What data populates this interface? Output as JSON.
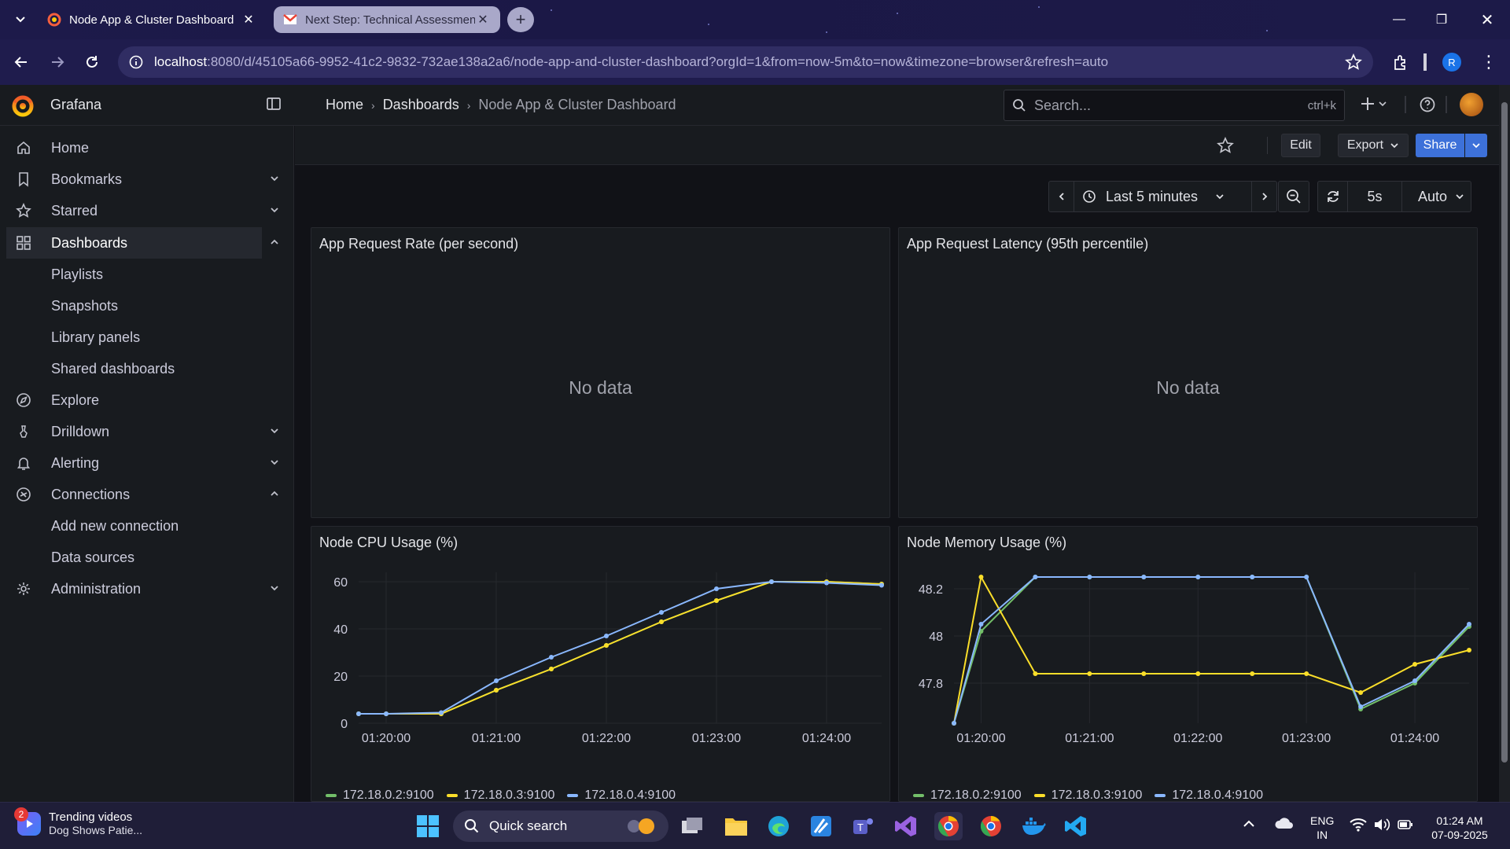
{
  "browser": {
    "tabs": [
      {
        "title": "Node App & Cluster Dashboard",
        "active": true
      },
      {
        "title": "Next Step: Technical Assessmen",
        "active": false
      }
    ],
    "url_host": "localhost",
    "url_rest": ":8080/d/45105a66-9952-41c2-9832-732ae138a2a6/node-app-and-cluster-dashboard?orgId=1&from=now-5m&to=now&timezone=browser&refresh=auto",
    "profile_initial": "R"
  },
  "grafana": {
    "app_title": "Grafana",
    "breadcrumbs": [
      "Home",
      "Dashboards",
      "Node App & Cluster Dashboard"
    ],
    "search_placeholder": "Search...",
    "search_shortcut": "ctrl+k",
    "actions": {
      "edit": "Edit",
      "export": "Export",
      "share": "Share"
    },
    "time_range": "Last 5 minutes",
    "refresh_interval": "5s",
    "auto": "Auto"
  },
  "sidebar": {
    "items": [
      {
        "label": "Home",
        "icon": "home-icon",
        "chevron": ""
      },
      {
        "label": "Bookmarks",
        "icon": "bookmark-icon",
        "chevron": "down"
      },
      {
        "label": "Starred",
        "icon": "star-icon",
        "chevron": "down"
      },
      {
        "label": "Dashboards",
        "icon": "apps-icon",
        "chevron": "up",
        "active": true
      },
      {
        "label": "Playlists",
        "sub": true
      },
      {
        "label": "Snapshots",
        "sub": true
      },
      {
        "label": "Library panels",
        "sub": true
      },
      {
        "label": "Shared dashboards",
        "sub": true
      },
      {
        "label": "Explore",
        "icon": "compass-icon",
        "chevron": ""
      },
      {
        "label": "Drilldown",
        "icon": "drilldown-icon",
        "chevron": "down"
      },
      {
        "label": "Alerting",
        "icon": "bell-icon",
        "chevron": "down"
      },
      {
        "label": "Connections",
        "icon": "connections-icon",
        "chevron": "up"
      },
      {
        "label": "Add new connection",
        "sub": true
      },
      {
        "label": "Data sources",
        "sub": true
      },
      {
        "label": "Administration",
        "icon": "cog-icon",
        "chevron": "down"
      }
    ]
  },
  "panels": {
    "rate": {
      "title": "App Request Rate (per second)",
      "empty": "No data"
    },
    "latency": {
      "title": "App Request Latency (95th percentile)",
      "empty": "No data"
    },
    "cpu": {
      "title": "Node CPU Usage (%)"
    },
    "mem": {
      "title": "Node Memory Usage (%)"
    }
  },
  "colors": {
    "green": "#73bf69",
    "yellow": "#fade2a",
    "blue": "#8ab8ff",
    "accent": "#f55f3e",
    "primary": "#3d71d9"
  },
  "chart_data": [
    {
      "type": "line",
      "title": "Node CPU Usage (%)",
      "x": [
        "01:19:45",
        "01:20:00",
        "01:20:30",
        "01:21:00",
        "01:21:15",
        "01:21:30",
        "01:22:00",
        "01:22:15",
        "01:22:30",
        "01:23:00",
        "01:23:15",
        "01:23:30",
        "01:24:00",
        "01:24:15"
      ],
      "xticks": [
        "01:20:00",
        "01:21:00",
        "01:22:00",
        "01:23:00",
        "01:24:00"
      ],
      "yticks": [
        0,
        20,
        40,
        60
      ],
      "ylim": [
        0,
        64
      ],
      "series": [
        {
          "name": "172.18.0.2:9100",
          "color": "#73bf69",
          "values": [
            4,
            4,
            4,
            14,
            23,
            33,
            43,
            52,
            60,
            60,
            59
          ]
        },
        {
          "name": "172.18.0.3:9100",
          "color": "#fade2a",
          "values": [
            4,
            4,
            4,
            14,
            23,
            33,
            43,
            52,
            60,
            60,
            59
          ]
        },
        {
          "name": "172.18.0.4:9100",
          "color": "#8ab8ff",
          "values": [
            4,
            4,
            4.5,
            18,
            28,
            37,
            47,
            57,
            60,
            59.5,
            58.5
          ]
        }
      ],
      "series_x": [
        "01:19:45",
        "01:20:00",
        "01:20:30",
        "01:20:45",
        "01:21:00",
        "01:21:15",
        "01:21:30",
        "01:22:00",
        "01:22:15",
        "01:22:30",
        "01:22:45"
      ]
    },
    {
      "type": "line",
      "title": "Node Memory Usage (%)",
      "xticks": [
        "01:20:00",
        "01:21:00",
        "01:22:00",
        "01:23:00",
        "01:24:00"
      ],
      "yticks": [
        47.8,
        48,
        48.2
      ],
      "ylim": [
        47.63,
        48.27
      ],
      "series_x": [
        "01:19:45",
        "01:20:00",
        "01:20:30",
        "01:21:00",
        "01:21:30",
        "01:22:00",
        "01:22:30",
        "01:23:00",
        "01:23:30",
        "01:24:00",
        "01:24:30"
      ],
      "series": [
        {
          "name": "172.18.0.2:9100",
          "color": "#73bf69",
          "values": [
            47.63,
            48.02,
            48.25,
            48.25,
            48.25,
            48.25,
            48.25,
            48.25,
            47.69,
            47.8,
            48.04
          ]
        },
        {
          "name": "172.18.0.3:9100",
          "color": "#fade2a",
          "values": [
            47.63,
            48.25,
            47.84,
            47.84,
            47.84,
            47.84,
            47.84,
            47.84,
            47.76,
            47.88,
            47.94
          ]
        },
        {
          "name": "172.18.0.4:9100",
          "color": "#8ab8ff",
          "values": [
            47.63,
            48.05,
            48.25,
            48.25,
            48.25,
            48.25,
            48.25,
            48.25,
            47.7,
            47.81,
            48.05
          ]
        }
      ]
    }
  ],
  "taskbar": {
    "news_title": "Trending videos",
    "news_sub": "Dog Shows Patie...",
    "news_badge": "2",
    "search_label": "Quick search",
    "lang1": "ENG",
    "lang2": "IN",
    "time": "01:24 AM",
    "date": "07-09-2025"
  }
}
